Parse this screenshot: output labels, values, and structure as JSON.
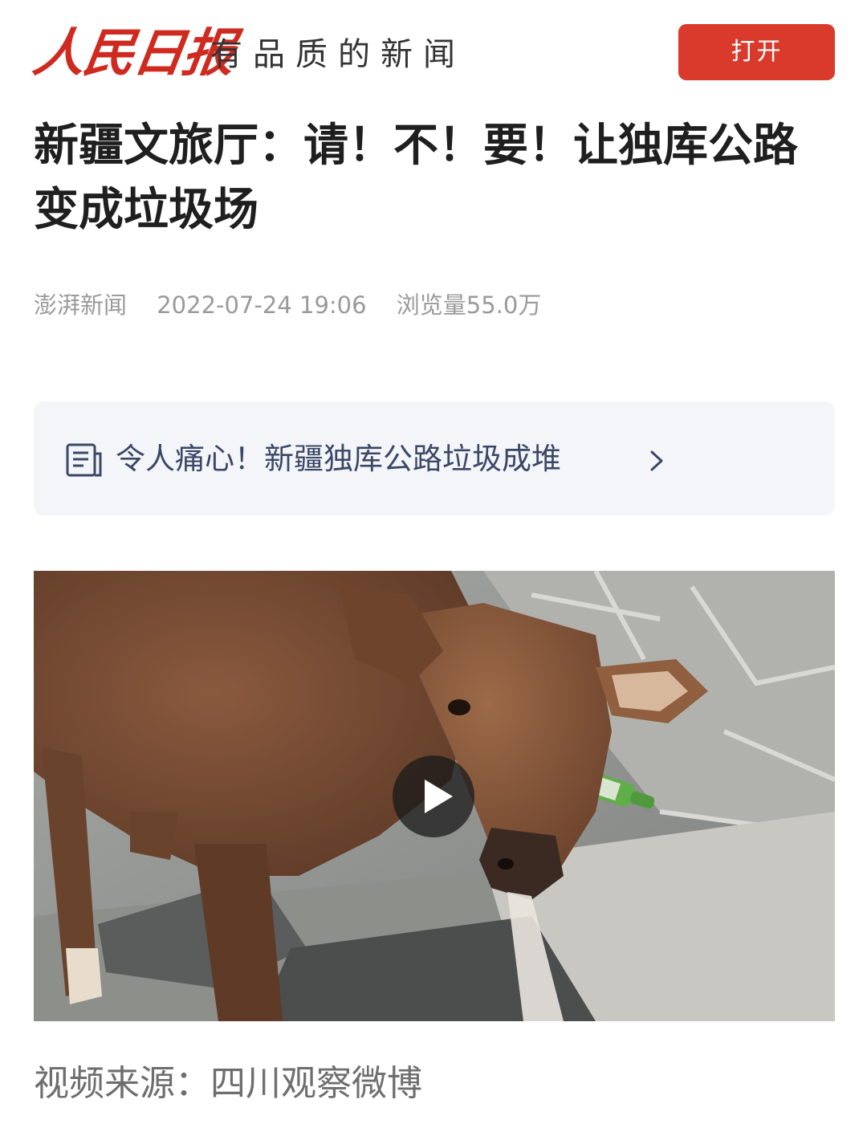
{
  "header": {
    "logo_text": "人民日报",
    "slogan": "有品质的新闻",
    "open_button_label": "打开"
  },
  "article": {
    "title": "新疆文旅厅：请！不！要！让独库公路变成垃圾场",
    "source": "澎湃新闻",
    "datetime": "2022-07-24 19:06",
    "views": "浏览量55.0万"
  },
  "related": {
    "icon": "document-icon",
    "text": "令人痛心！新疆独库公路垃圾成堆",
    "chevron_icon": "chevron-right-icon"
  },
  "video": {
    "play_icon": "play-icon",
    "description": "calf-on-rocks-video-thumbnail"
  },
  "caption": "视频来源：四川观察微博",
  "colors": {
    "brand_red": "#cf2a1f",
    "button_red": "#d93a2c",
    "related_bg": "#f3f5f8",
    "related_text": "#3a4766",
    "meta_gray": "#9a9a9a"
  }
}
